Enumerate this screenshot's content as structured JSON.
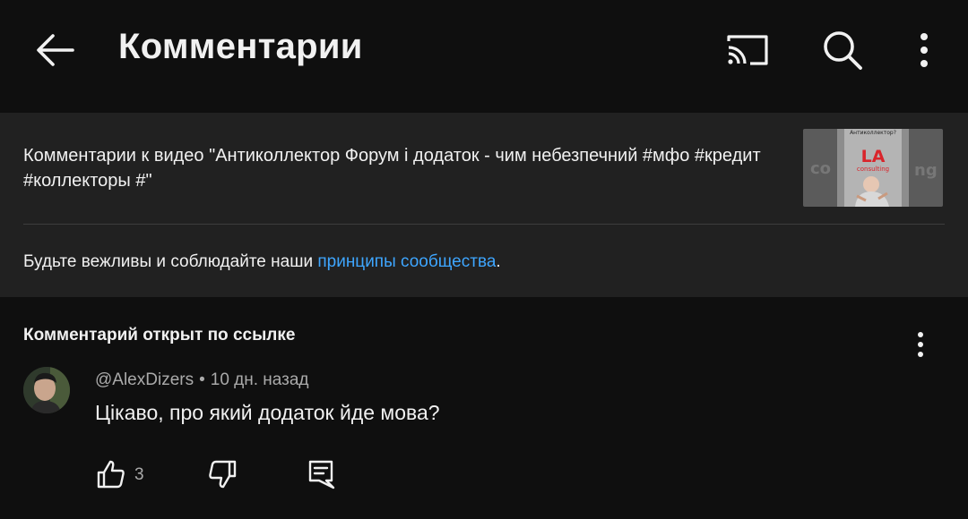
{
  "header": {
    "title": "Комментарии",
    "back_icon": "arrow-left-icon",
    "cast_icon": "cast-icon",
    "search_icon": "search-icon",
    "more_icon": "more-vert-icon"
  },
  "video": {
    "caption": "Комментарии к видео \"Антиколлектор Форум і додаток  - чим небезпечний #мфо #кредит #коллекторы #\"",
    "thumbnail_text": {
      "top": "Антиколлектор?",
      "logo": "LA",
      "sub": "consulting"
    }
  },
  "rules": {
    "prefix": "Будьте вежливы и соблюдайте наши ",
    "link": "принципы сообщества",
    "suffix": "."
  },
  "comment": {
    "section_label": "Комментарий открыт по ссылке",
    "author": "@AlexDizers",
    "separator": "•",
    "time": "10 дн. назад",
    "text": "Цікаво, про який додаток йде мова?",
    "likes": "3"
  },
  "colors": {
    "background": "#0f0f0f",
    "card": "#212121",
    "link": "#3ea6ff",
    "secondary_text": "#aaaaaa"
  }
}
